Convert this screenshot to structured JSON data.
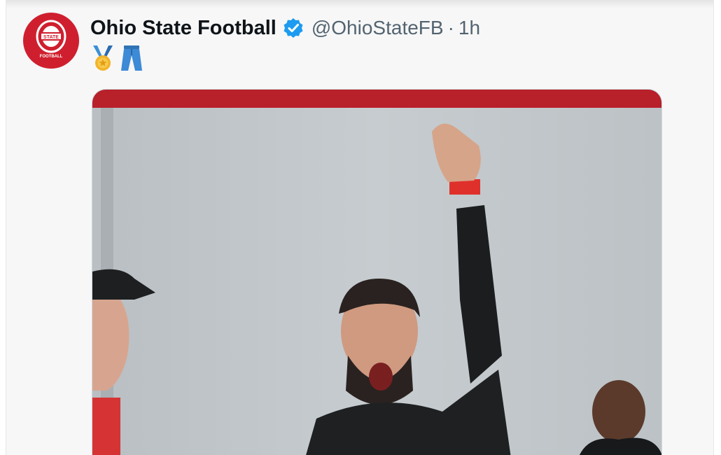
{
  "tweet": {
    "author_name": "Ohio State Football",
    "handle": "@OhioStateFB",
    "separator": "·",
    "time": "1h",
    "verified": true,
    "text_emojis": [
      "medal-icon",
      "jeans-icon"
    ],
    "avatar_logo_text": "FOOTBALL"
  },
  "colors": {
    "brand_red": "#cf1f2e",
    "verified_blue": "#1d9bf0",
    "handle_gray": "#536471"
  },
  "media": {
    "description_icon": "photo-coach-celebrating"
  }
}
